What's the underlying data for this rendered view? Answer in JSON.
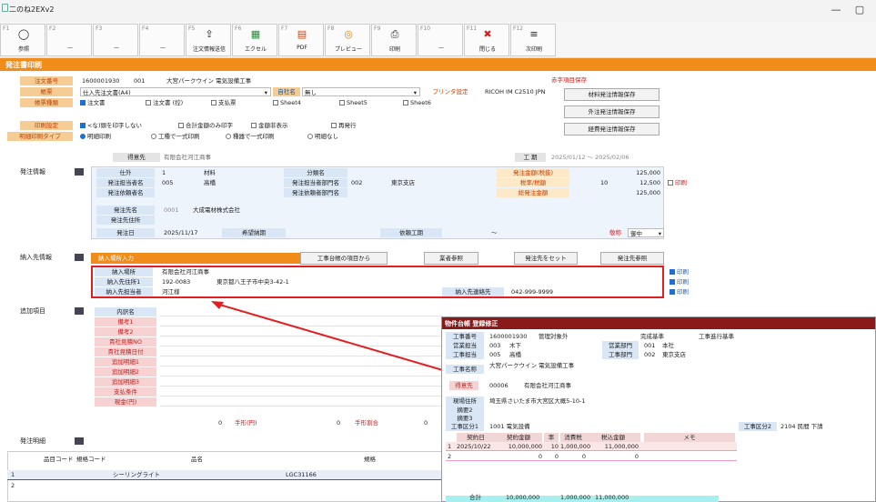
{
  "window": {
    "title": "二のね2EXv2",
    "minimize": "—",
    "restore": "▢"
  },
  "fkeys": [
    {
      "key": "F1",
      "label": "参照",
      "icon": "search-icon"
    },
    {
      "key": "F2",
      "label": "—",
      "icon": ""
    },
    {
      "key": "F3",
      "label": "—",
      "icon": ""
    },
    {
      "key": "F4",
      "label": "—",
      "icon": ""
    },
    {
      "key": "F5",
      "label": "注文情報送信",
      "icon": "send-icon"
    },
    {
      "key": "F6",
      "label": "エクセル",
      "icon": "excel-icon"
    },
    {
      "key": "F7",
      "label": "PDF",
      "icon": "pdf-icon"
    },
    {
      "key": "F8",
      "label": "プレビュー",
      "icon": "preview-icon"
    },
    {
      "key": "F9",
      "label": "印刷",
      "icon": "print-icon"
    },
    {
      "key": "F10",
      "label": "—",
      "icon": ""
    },
    {
      "key": "F11",
      "label": "閉じる",
      "icon": "close-icon"
    },
    {
      "key": "F12",
      "label": "次印刷",
      "icon": "next-print-icon"
    }
  ],
  "page_title": "発注書印刷",
  "header": {
    "order_no_label": "注文番号",
    "order_no": "1600001930",
    "order_sub": "001",
    "order_name": "大宮パークウイン 電気設備工事",
    "form_label": "帳票",
    "form_value": "仕入先注文書(A4)",
    "company_label": "自社名",
    "company_value": "無し",
    "printer_label": "プリンタ設定",
    "printer_value": "RICOH IM C2510 JPN",
    "type_label": "帳票種類",
    "types": [
      "注文書",
      "注文書 (控)",
      "支払票",
      "Sheet4",
      "Sheet5",
      "Sheet6"
    ],
    "print_setting_label": "印刷設定",
    "print_options": [
      "<な)頭を印字しない",
      "合計金額のみ印字",
      "金額非表示",
      "再発行"
    ],
    "detail_label": "明細印刷タイプ",
    "detail_options": [
      "明細印刷",
      "工種で一式印刷",
      "種器で一式印刷",
      "明細なし"
    ],
    "save_title": "赤字項目保存",
    "save_buttons": [
      "材料発注情報保存",
      "外注発注情報保存",
      "経費発注情報保存"
    ]
  },
  "client": {
    "label": "得意先",
    "value": "有限会社河江商事",
    "period_label": "工 期",
    "period_value": "2025/01/12 ～ 2025/02/06"
  },
  "order_info": {
    "section": "発注情報",
    "rows": [
      {
        "l1": "仕外",
        "v1": "1",
        "v1b": "材料",
        "l2": "分類名",
        "v2": ""
      },
      {
        "l1": "発注担当者名",
        "v1": "005",
        "v1b": "高橋",
        "l2": "発注担当者部門名",
        "v2": "002",
        "v2b": "東京支店"
      },
      {
        "l1": "発注依頼者名",
        "v1": "",
        "v1b": "",
        "l2": "発注依頼者部門名",
        "v2": ""
      }
    ],
    "amount_label": "発注金額(税抜)",
    "amount": "125,000",
    "tax_label": "税率/税額",
    "tax_rate": "10",
    "tax": "12,500",
    "print_label": "印刷",
    "total_label": "総発注金額",
    "total": "125,000",
    "supplier_label": "発注先名",
    "supplier_code": "0001",
    "supplier_name": "大成電材株式会社",
    "supplier_addr_label": "発注先住所",
    "date_label": "発注日",
    "date": "2025/11/17",
    "delivery_label": "希望納期",
    "period2_label": "依頼工期",
    "tilde": "～",
    "honorific_label": "敬称",
    "honorific": "御中"
  },
  "delivery": {
    "section": "納入先情報",
    "input_label": "納入場所入力",
    "btn1": "工事台帳の項目から",
    "btn2": "業者参照",
    "btn3": "発注先をセット",
    "btn4": "発注先参照",
    "place_label": "納入場所",
    "place": "有限会社河江商事",
    "addr_label": "納入先住所1",
    "zip": "192-0083",
    "addr": "東京都八王子市中央3-42-1",
    "person_label": "納入先担当者",
    "person": "河江様",
    "contact_label": "納入先連絡先",
    "contact": "042-999-9999",
    "print": "印刷"
  },
  "extra": {
    "section": "追加項目",
    "items": [
      "内訳名",
      "備考1",
      "備考2",
      "貴社見積NO",
      "貴社見積日付",
      "追加明細1",
      "追加明細2",
      "追加明細3",
      "支払条件",
      "現金(円)"
    ],
    "cash": "0",
    "bill_label": "手形(円)",
    "bill": "0",
    "bill_rate_label": "手形割合",
    "bill_rate": "0"
  },
  "detail": {
    "section": "発注明細",
    "cols": [
      "品目コード",
      "規格コード",
      "品名",
      "規格"
    ],
    "rows": [
      {
        "no": "1",
        "name": "シーリングライト",
        "spec": "LGC31166"
      },
      {
        "no": "2",
        "name": "",
        "spec": ""
      }
    ]
  },
  "dialog": {
    "title": "物件台帳 登録修正",
    "koji_no_label": "工事番号",
    "koji_no": "1600001930",
    "managed_label": "管理対象外",
    "done_label": "完成基準",
    "progress_label": "工事進行基準",
    "sales_label": "営業担当",
    "sales": "003",
    "sales_name": "木下",
    "sales_dept_label": "営業部門",
    "sales_dept": "001",
    "sales_dept_name": "本社",
    "site_label": "工事担当",
    "site": "005",
    "site_name": "高橋",
    "site_dept_label": "工事部門",
    "site_dept": "002",
    "site_dept_name": "東京支店",
    "kname_label": "工事名称",
    "kname": "大宮パークウイン 電気設備工事",
    "client_label": "得意先",
    "client_code": "00006",
    "client_name": "有限会社河江商事",
    "addr_label": "現場住所",
    "addr": "埼玉県さいたま市大宮区大概5-10-1",
    "remark2_label": "摘要2",
    "remark3_label": "摘要3",
    "kbn1_label": "工事区分1",
    "kbn1": "1001 電気設備",
    "kbn2_label": "工事区分2",
    "kbn2": "2104 民間 下請",
    "table_cols": [
      "契約日",
      "契約金額",
      "率",
      "消費税",
      "税込金額",
      "メモ"
    ],
    "table_rows": [
      {
        "no": "1",
        "date": "2025/10/22",
        "amount": "10,000,000",
        "rate": "10",
        "tax": "1,000,000",
        "total": "11,000,000"
      },
      {
        "no": "2",
        "date": "",
        "amount": "0",
        "rate": "0",
        "tax": "0",
        "total": "0"
      }
    ],
    "sum_label": "合計",
    "sum_amount": "10,000,000",
    "sum_tax": "1,000,000",
    "sum_total": "11,000,000"
  }
}
